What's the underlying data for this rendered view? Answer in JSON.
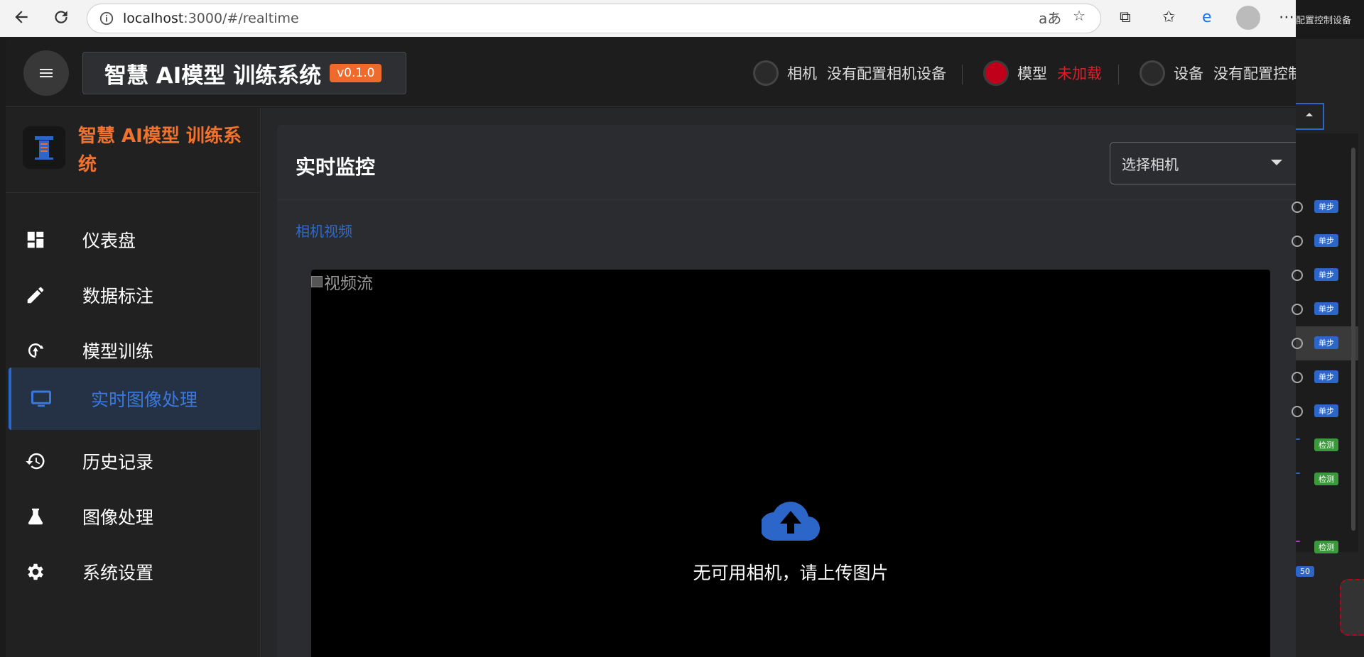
{
  "browser": {
    "url_host": "localhost",
    "url_path": ":3000/#/realtime"
  },
  "app": {
    "brand_title": "智慧 AI模型 训练系统",
    "version": "v0.1.0",
    "status": [
      {
        "label": "相机",
        "value": "没有配置相机设备",
        "state": "off"
      },
      {
        "label": "模型",
        "value": "未加载",
        "state": "error"
      },
      {
        "label": "设备",
        "value": "没有配置控制",
        "state": "off"
      }
    ]
  },
  "sidebar": {
    "title": "智慧 AI模型 训练系统",
    "items": [
      {
        "label": "仪表盘",
        "icon": "dashboard-icon"
      },
      {
        "label": "数据标注",
        "icon": "pencil-icon"
      },
      {
        "label": "模型训练",
        "icon": "training-icon"
      },
      {
        "label": "实时图像处理",
        "icon": "monitor-icon",
        "active": true
      },
      {
        "label": "历史记录",
        "icon": "history-icon"
      },
      {
        "label": "图像处理",
        "icon": "flask-icon"
      },
      {
        "label": "系统设置",
        "icon": "gear-icon"
      }
    ]
  },
  "main": {
    "title": "实时监控",
    "camera_select_placeholder": "选择相机",
    "section_link": "相机视频",
    "video_alt": "视频流",
    "empty_message": "无可用相机，请上传图片"
  },
  "background_window": {
    "top_text": "配置控制设备",
    "badges": [
      "单步",
      "单步",
      "单步",
      "单步",
      "单步",
      "单步",
      "单步",
      "检测",
      "检测",
      "检测"
    ],
    "page_badge": "50"
  },
  "colors": {
    "accent_orange": "#ee6a2d",
    "accent_blue": "#2d66c9",
    "error_red": "#e01e2a"
  }
}
